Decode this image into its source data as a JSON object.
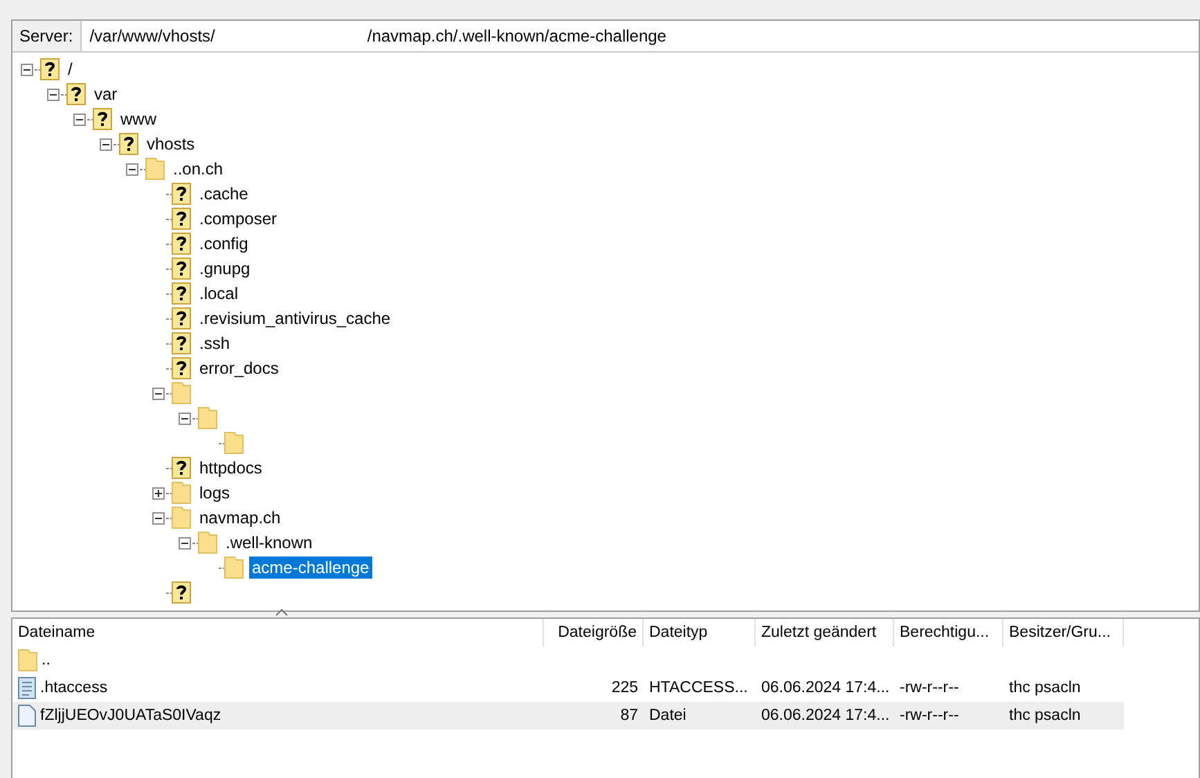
{
  "server_bar": {
    "label": "Server:",
    "path_start": "/var/www/vhosts/",
    "path_end": "/navmap.ch/.well-known/acme-challenge"
  },
  "tree": [
    {
      "label": "/",
      "kind": "unknown",
      "expanded": true,
      "children": [
        {
          "label": "var",
          "kind": "unknown",
          "expanded": true,
          "children": [
            {
              "label": "www",
              "kind": "unknown",
              "expanded": true,
              "children": [
                {
                  "label": "vhosts",
                  "kind": "unknown",
                  "expanded": true,
                  "children": [
                    {
                      "label": "..on.ch",
                      "kind": "folder",
                      "expanded": true,
                      "children": [
                        {
                          "label": ".cache",
                          "kind": "unknown",
                          "selected": false
                        },
                        {
                          "label": ".composer",
                          "kind": "unknown",
                          "selected": false
                        },
                        {
                          "label": ".config",
                          "kind": "unknown",
                          "selected": false
                        },
                        {
                          "label": ".gnupg",
                          "kind": "unknown",
                          "selected": false
                        },
                        {
                          "label": ".local",
                          "kind": "unknown",
                          "selected": false
                        },
                        {
                          "label": ".revisium_antivirus_cache",
                          "kind": "unknown",
                          "selected": false
                        },
                        {
                          "label": ".ssh",
                          "kind": "unknown",
                          "selected": false
                        },
                        {
                          "label": "error_docs",
                          "kind": "unknown",
                          "selected": false
                        },
                        {
                          "kind": "folder",
                          "expanded": true,
                          "children": [
                            {
                              "kind": "folder",
                              "expanded": true,
                              "children": [
                                {
                                  "kind": "folder"
                                }
                              ]
                            }
                          ]
                        },
                        {
                          "label": "httpdocs",
                          "kind": "unknown",
                          "selected": false
                        },
                        {
                          "label": "logs",
                          "kind": "folder",
                          "expanded": false,
                          "selected": false
                        },
                        {
                          "label": "navmap.ch",
                          "kind": "folder",
                          "expanded": true,
                          "children": [
                            {
                              "label": ".well-known",
                              "kind": "folder",
                              "expanded": true,
                              "children": [
                                {
                                  "label": "acme-challenge",
                                  "kind": "folder",
                                  "selected": true
                                }
                              ]
                            }
                          ]
                        },
                        {
                          "kind": "unknown"
                        }
                      ]
                    }
                  ]
                }
              ]
            }
          ]
        }
      ]
    }
  ],
  "file_list": {
    "columns": [
      "Dateiname",
      "Dateigröße",
      "Dateityp",
      "Zuletzt geändert",
      "Berechtigu...",
      "Besitzer/Gru..."
    ],
    "rows": [
      {
        "kind": "folder",
        "name": "..",
        "selected": false
      },
      {
        "kind": "text",
        "name": ".htaccess",
        "size": "225",
        "type": "HTACCESS...",
        "modified": "06.06.2024 17:4...",
        "permissions": "-rw-r--r--",
        "owner": "thc psacln",
        "selected": false
      },
      {
        "kind": "file",
        "name": "fZljjUEOvJ0UATaS0IVaqz",
        "size": "87",
        "type": "Datei",
        "modified": "06.06.2024 17:4...",
        "permissions": "-rw-r--r--",
        "owner": "thc psacln",
        "selected": true
      }
    ]
  }
}
